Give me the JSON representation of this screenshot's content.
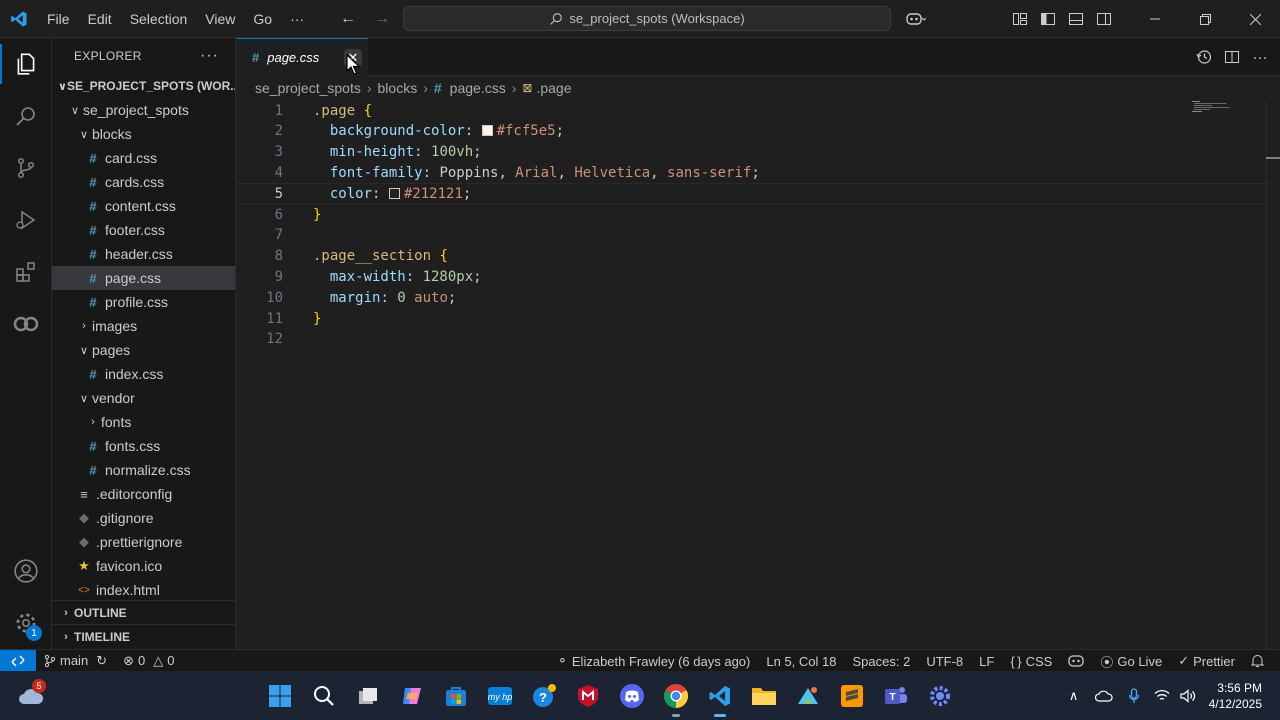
{
  "menu": [
    "File",
    "Edit",
    "Selection",
    "View",
    "Go",
    "···"
  ],
  "search": {
    "label": "se_project_spots (Workspace)"
  },
  "sidebar": {
    "title": "EXPLORER",
    "workspace": "SE_PROJECT_SPOTS (WOR...",
    "tree": [
      {
        "label": "se_project_spots",
        "type": "folder",
        "open": true,
        "depth": 1
      },
      {
        "label": "blocks",
        "type": "folder",
        "open": true,
        "depth": 2
      },
      {
        "label": "card.css",
        "type": "css",
        "depth": 3
      },
      {
        "label": "cards.css",
        "type": "css",
        "depth": 3
      },
      {
        "label": "content.css",
        "type": "css",
        "depth": 3
      },
      {
        "label": "footer.css",
        "type": "css",
        "depth": 3
      },
      {
        "label": "header.css",
        "type": "css",
        "depth": 3
      },
      {
        "label": "page.css",
        "type": "css",
        "depth": 3,
        "selected": true
      },
      {
        "label": "profile.css",
        "type": "css",
        "depth": 3
      },
      {
        "label": "images",
        "type": "folder",
        "open": false,
        "depth": 2
      },
      {
        "label": "pages",
        "type": "folder",
        "open": true,
        "depth": 2
      },
      {
        "label": "index.css",
        "type": "css",
        "depth": 3
      },
      {
        "label": "vendor",
        "type": "folder",
        "open": true,
        "depth": 2
      },
      {
        "label": "fonts",
        "type": "folder",
        "open": false,
        "depth": 3
      },
      {
        "label": "fonts.css",
        "type": "css",
        "depth": 3
      },
      {
        "label": "normalize.css",
        "type": "css",
        "depth": 3
      },
      {
        "label": ".editorconfig",
        "type": "config",
        "depth": 2
      },
      {
        "label": ".gitignore",
        "type": "git",
        "depth": 2
      },
      {
        "label": ".prettierignore",
        "type": "prettier",
        "depth": 2
      },
      {
        "label": "favicon.ico",
        "type": "star",
        "depth": 2
      },
      {
        "label": "index.html",
        "type": "html",
        "depth": 2
      }
    ],
    "outline": "OUTLINE",
    "timeline": "TIMELINE"
  },
  "tab": {
    "title": "page.css"
  },
  "breadcrumbs": [
    "se_project_spots",
    "blocks",
    "page.css",
    ".page"
  ],
  "code": [
    [
      [
        "sel",
        ".page "
      ],
      [
        "brace",
        "{"
      ]
    ],
    [
      [
        "ind",
        "  "
      ],
      [
        "prop",
        "background-color"
      ],
      [
        "punc",
        ": "
      ],
      [
        "sw",
        "#fcf5e5"
      ],
      [
        "val",
        "#fcf5e5"
      ],
      [
        "punc",
        ";"
      ]
    ],
    [
      [
        "ind",
        "  "
      ],
      [
        "prop",
        "min-height"
      ],
      [
        "punc",
        ": "
      ],
      [
        "num",
        "100vh"
      ],
      [
        "punc",
        ";"
      ]
    ],
    [
      [
        "ind",
        "  "
      ],
      [
        "prop",
        "font-family"
      ],
      [
        "punc",
        ": "
      ],
      [
        "punc",
        "Poppins, "
      ],
      [
        "val",
        "Arial"
      ],
      [
        "punc",
        ", "
      ],
      [
        "val",
        "Helvetica"
      ],
      [
        "punc",
        ", "
      ],
      [
        "val",
        "sans-serif"
      ],
      [
        "punc",
        ";"
      ]
    ],
    [
      [
        "ind",
        "  "
      ],
      [
        "prop",
        "color"
      ],
      [
        "punc",
        ": "
      ],
      [
        "sw",
        "#212121"
      ],
      [
        "val",
        "#212121"
      ],
      [
        "punc",
        ";"
      ]
    ],
    [
      [
        "brace",
        "}"
      ]
    ],
    [],
    [
      [
        "sel",
        ".page__section "
      ],
      [
        "brace",
        "{"
      ]
    ],
    [
      [
        "ind",
        "  "
      ],
      [
        "prop",
        "max-width"
      ],
      [
        "punc",
        ": "
      ],
      [
        "num",
        "1280px"
      ],
      [
        "punc",
        ";"
      ]
    ],
    [
      [
        "ind",
        "  "
      ],
      [
        "prop",
        "margin"
      ],
      [
        "punc",
        ": "
      ],
      [
        "num",
        "0"
      ],
      [
        "punc",
        " "
      ],
      [
        "val",
        "auto"
      ],
      [
        "punc",
        ";"
      ]
    ],
    [
      [
        "brace",
        "}"
      ]
    ],
    []
  ],
  "current_line": 5,
  "status": {
    "branch": "main",
    "errors": "0",
    "warnings": "0",
    "blame": "Elizabeth Frawley (6 days ago)",
    "position": "Ln 5, Col 18",
    "spaces": "Spaces: 2",
    "encoding": "UTF-8",
    "eol": "LF",
    "language": "CSS",
    "golive": "Go Live",
    "prettier": "Prettier"
  },
  "activity_badge": "1",
  "taskbar": {
    "weather_badge": "5",
    "time": "3:56 PM",
    "date": "4/12/2025"
  },
  "colors": {
    "accent": "#0078d4",
    "swatch_bg": "#fcf5e5",
    "swatch_text": "#212121"
  }
}
